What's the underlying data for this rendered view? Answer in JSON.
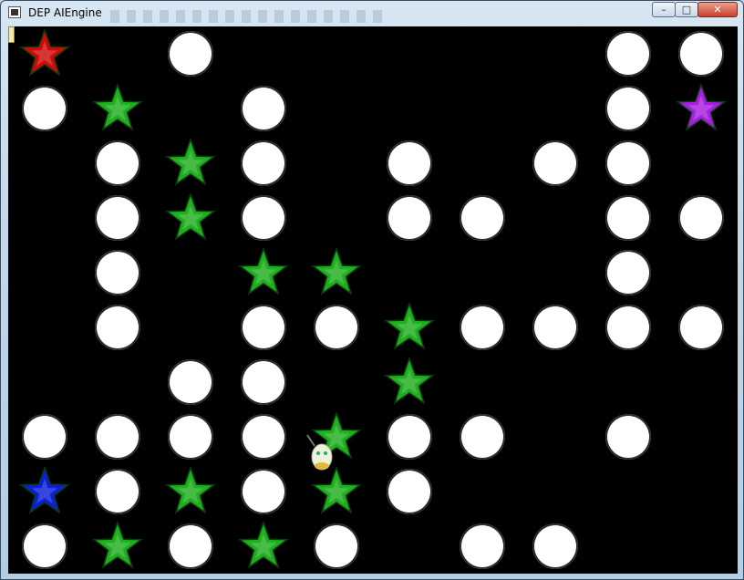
{
  "window": {
    "title": "DEP AIEngine"
  },
  "controls": {
    "minimize": "–",
    "maximize": "□",
    "close": "✕"
  },
  "colors": {
    "background": "#000000",
    "pellet": "#ffffff",
    "green_star": "#1fae1f",
    "red_star": "#cc0a0a",
    "blue_star": "#0a1fd6",
    "purple_star": "#a61fe0"
  },
  "grid": {
    "cols": 10,
    "rows": 10,
    "pellets": [
      [
        2,
        0
      ],
      [
        8,
        0
      ],
      [
        9,
        0
      ],
      [
        0,
        1
      ],
      [
        3,
        1
      ],
      [
        8,
        1
      ],
      [
        1,
        2
      ],
      [
        3,
        2
      ],
      [
        5,
        2
      ],
      [
        7,
        2
      ],
      [
        8,
        2
      ],
      [
        1,
        3
      ],
      [
        3,
        3
      ],
      [
        5,
        3
      ],
      [
        6,
        3
      ],
      [
        8,
        3
      ],
      [
        9,
        3
      ],
      [
        1,
        4
      ],
      [
        8,
        4
      ],
      [
        1,
        5
      ],
      [
        3,
        5
      ],
      [
        4,
        5
      ],
      [
        6,
        5
      ],
      [
        7,
        5
      ],
      [
        8,
        5
      ],
      [
        9,
        5
      ],
      [
        2,
        6
      ],
      [
        3,
        6
      ],
      [
        0,
        7
      ],
      [
        1,
        7
      ],
      [
        2,
        7
      ],
      [
        3,
        7
      ],
      [
        5,
        7
      ],
      [
        6,
        7
      ],
      [
        8,
        7
      ],
      [
        1,
        8
      ],
      [
        3,
        8
      ],
      [
        5,
        8
      ],
      [
        0,
        9
      ],
      [
        2,
        9
      ],
      [
        4,
        9
      ],
      [
        6,
        9
      ],
      [
        7,
        9
      ]
    ],
    "green_stars": [
      [
        1,
        1
      ],
      [
        2,
        2
      ],
      [
        2,
        3
      ],
      [
        3,
        4
      ],
      [
        4,
        4
      ],
      [
        5,
        5
      ],
      [
        5,
        6
      ],
      [
        4,
        7
      ],
      [
        2,
        8
      ],
      [
        4,
        8
      ],
      [
        1,
        9
      ],
      [
        3,
        9
      ]
    ],
    "special_stars": [
      {
        "col": 0,
        "row": 0,
        "color": "red"
      },
      {
        "col": 9,
        "row": 1,
        "color": "purple"
      },
      {
        "col": 0,
        "row": 8,
        "color": "blue"
      }
    ]
  }
}
